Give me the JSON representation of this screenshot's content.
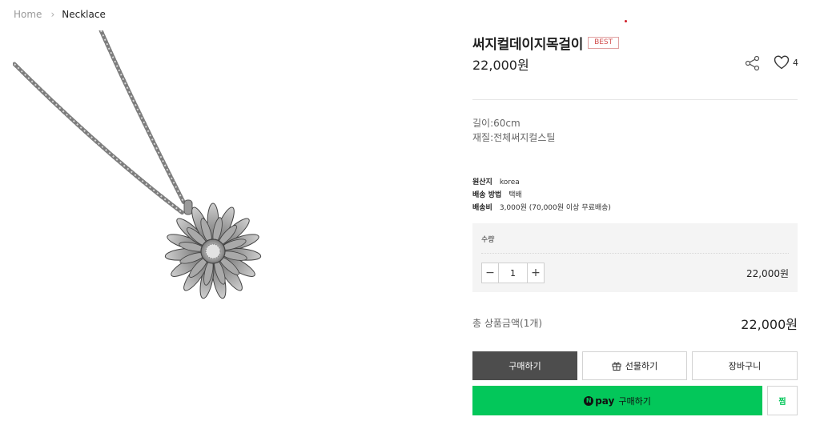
{
  "breadcrumb": {
    "home": "Home",
    "separator": "›",
    "current": "Necklace"
  },
  "product": {
    "title": "써지컬데이지목걸이",
    "badge": "BEST",
    "price": "22,000원",
    "like_count": "4",
    "description": [
      "길이:60cm",
      "재질:전체써지컬스틸"
    ]
  },
  "info": [
    {
      "label": "원산지",
      "value": "korea"
    },
    {
      "label": "배송 방법",
      "value": "택배"
    },
    {
      "label": "배송비",
      "value": "3,000원 (70,000원 이상 무료배송)"
    }
  ],
  "quantity": {
    "label": "수량",
    "minus": "−",
    "plus": "+",
    "value": "1",
    "line_price": "22,000원"
  },
  "total": {
    "label": "총 상품금액(1개)",
    "price": "22,000원"
  },
  "buttons": {
    "buy": "구매하기",
    "gift": "선물하기",
    "cart": "장바구니",
    "npay_logo": "N",
    "npay_word": "pay",
    "npay_label": "구매하기",
    "wish": "찜"
  },
  "colors": {
    "npay_green": "#03c75a",
    "buy_button": "#4d4d4d",
    "best_badge": "#d25050",
    "quantity_box": "#f4f4f4"
  },
  "icons": {
    "share": "share-icon",
    "like": "heart-icon",
    "gift": "gift-icon"
  }
}
